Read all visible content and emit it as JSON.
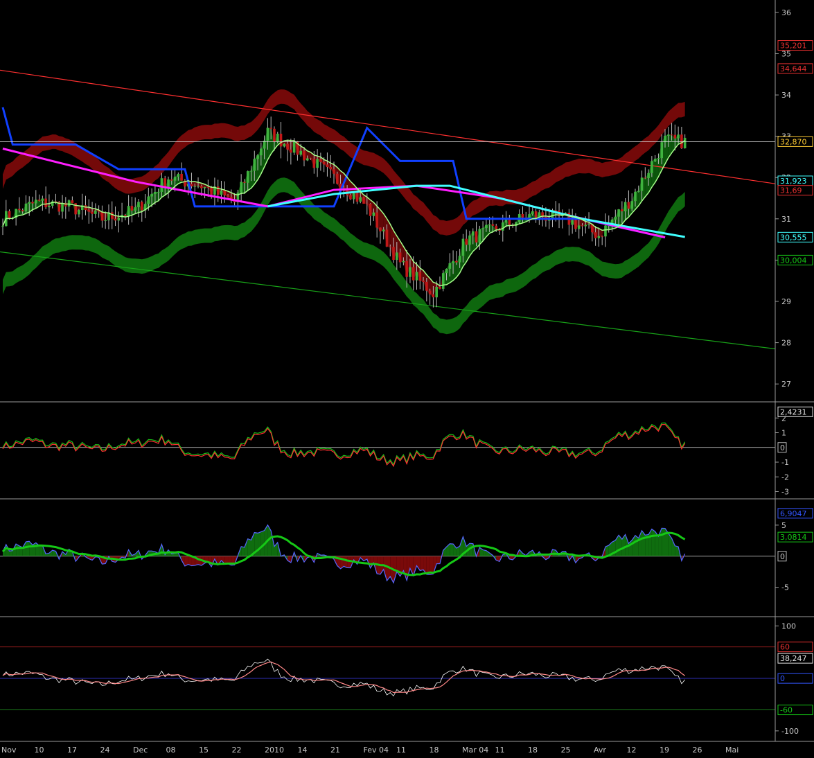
{
  "colors": {
    "bg": "#000000",
    "axis": "#9a9a9a",
    "text": "#c8c8c8",
    "bull": "#3fb33f",
    "bear": "#c21818",
    "cloud_red": "#7a0a0a",
    "cloud_green": "#0f6d0f",
    "blue": "#1040ff",
    "magenta": "#ff1eff",
    "cyan": "#40ffff",
    "red": "#ff3030",
    "lightgreen": "#a6ff8a",
    "green": "#16c816"
  },
  "x_ticks": [
    "Nov",
    "10",
    "17",
    "24",
    "Dec",
    "08",
    "15",
    "22",
    "2010",
    "14",
    "21",
    "Fev 04",
    "11",
    "18",
    "Mar 04",
    "11",
    "18",
    "25",
    "Avr",
    "12",
    "19",
    "26",
    "Mai"
  ],
  "panels": {
    "price": {
      "y_ticks": [
        "36",
        "35",
        "34",
        "33",
        "32",
        "31",
        "30",
        "29",
        "28",
        "27"
      ],
      "labels": [
        {
          "text": "35,201",
          "v": 35.2,
          "color": "#e83030"
        },
        {
          "text": "34,644",
          "v": 34.64,
          "color": "#e83030"
        },
        {
          "text": "32,870",
          "v": 32.87,
          "color": "#ffcc33"
        },
        {
          "text": "31,923",
          "v": 31.92,
          "color": "#40ffff"
        },
        {
          "text": "31,69",
          "v": 31.69,
          "color": "#e83030"
        },
        {
          "text": "30,555",
          "v": 30.555,
          "color": "#40ffff"
        },
        {
          "text": "30,004",
          "v": 30.0,
          "color": "#16c816"
        }
      ]
    },
    "osc1": {
      "y_ticks": [
        "2",
        "1",
        "-1",
        "-2",
        "-3"
      ],
      "zero_label": "0",
      "labels": [
        {
          "text": "2,4231",
          "v": 2.42,
          "color": "#e0e0e0"
        }
      ]
    },
    "osc2": {
      "y_ticks": [
        "5",
        "-5"
      ],
      "zero_label": "0",
      "labels": [
        {
          "text": "6,9047",
          "v": 6.9,
          "color": "#3355ff"
        },
        {
          "text": "3,0814",
          "v": 3.08,
          "color": "#16c816"
        }
      ]
    },
    "osc3": {
      "y_ticks": [
        "100",
        "-100"
      ],
      "labels": [
        {
          "text": "60",
          "v": 60,
          "color": "#e83030"
        },
        {
          "text": "38,247",
          "v": 38.25,
          "color": "#e0e0e0"
        },
        {
          "text": "0",
          "v": 0,
          "color": "#3355ff"
        },
        {
          "text": "-60",
          "v": -60,
          "color": "#16c816"
        }
      ]
    }
  },
  "chart_data": {
    "type": "line",
    "x_axis": [
      "Nov",
      "10",
      "17",
      "24",
      "Dec",
      "08",
      "15",
      "22",
      "2010",
      "14",
      "21",
      "Fev 04",
      "11",
      "18",
      "Mar 04",
      "11",
      "18",
      "25",
      "Avr",
      "12",
      "19",
      "26",
      "Mai"
    ],
    "price_axis": {
      "ylim": [
        26.6,
        36.3
      ],
      "ticks": [
        27,
        28,
        29,
        30,
        31,
        32,
        33,
        34,
        35,
        36
      ]
    },
    "price_close_key": [
      [
        0,
        31.0
      ],
      [
        10,
        31.4
      ],
      [
        20,
        31.3
      ],
      [
        30,
        31.0
      ],
      [
        40,
        31.2
      ],
      [
        50,
        32.0
      ],
      [
        60,
        31.8
      ],
      [
        70,
        31.4
      ],
      [
        80,
        33.1
      ],
      [
        90,
        32.6
      ],
      [
        100,
        32.0
      ],
      [
        110,
        31.3
      ],
      [
        120,
        29.9
      ],
      [
        130,
        29.2
      ],
      [
        140,
        30.5
      ],
      [
        150,
        30.8
      ],
      [
        160,
        31.1
      ],
      [
        170,
        31.0
      ],
      [
        180,
        30.6
      ],
      [
        190,
        31.5
      ],
      [
        200,
        32.9
      ],
      [
        206,
        32.87
      ]
    ],
    "series_values": {
      "blue_line": [
        [
          0,
          33.7
        ],
        [
          3,
          32.8
        ],
        [
          22,
          32.8
        ],
        [
          35,
          32.2
        ],
        [
          55,
          32.2
        ],
        [
          58,
          31.3
        ],
        [
          100,
          31.3
        ],
        [
          110,
          33.2
        ],
        [
          120,
          32.4
        ],
        [
          136,
          32.4
        ],
        [
          140,
          31.0
        ],
        [
          175,
          31.0
        ],
        [
          200,
          30.55
        ]
      ],
      "magenta_line": [
        [
          0,
          32.7
        ],
        [
          20,
          32.3
        ],
        [
          40,
          31.9
        ],
        [
          60,
          31.6
        ],
        [
          80,
          31.3
        ],
        [
          100,
          31.7
        ],
        [
          125,
          31.8
        ],
        [
          150,
          31.5
        ],
        [
          170,
          31.1
        ],
        [
          200,
          30.55
        ]
      ],
      "cyan_line": [
        [
          80,
          31.3
        ],
        [
          100,
          31.6
        ],
        [
          125,
          31.8
        ],
        [
          135,
          31.8
        ],
        [
          175,
          31.0
        ],
        [
          206,
          30.56
        ]
      ],
      "red_trend": [
        [
          0,
          34.6
        ],
        [
          120,
          33.6
        ],
        [
          206,
          31.9
        ]
      ],
      "green_trend": [
        [
          0,
          30.2
        ],
        [
          100,
          29.1
        ],
        [
          206,
          27.9
        ]
      ]
    },
    "oscillators": [
      {
        "name": "osc1",
        "ylim": [
          -3.4,
          3.0
        ],
        "last": 2.4231
      },
      {
        "name": "osc2",
        "ylim": [
          -9.5,
          9.0
        ],
        "values_last": [
          6.9047,
          3.0814
        ]
      },
      {
        "name": "osc3",
        "ylim": [
          -120,
          115
        ],
        "levels": [
          60,
          0,
          -60
        ],
        "last": 38.247
      }
    ]
  }
}
